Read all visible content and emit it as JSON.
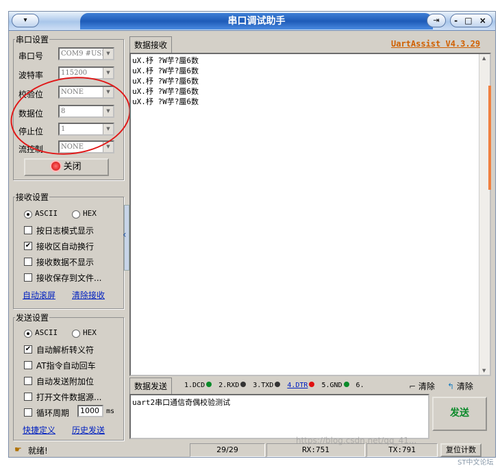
{
  "window": {
    "title": "串口调试助手",
    "version": "UartAssist V4.3.29",
    "controls": "- □ ×",
    "pin": "⇥"
  },
  "serial": {
    "legend": "串口设置",
    "port_label": "串口号",
    "port_value": "COM9 #USI",
    "baud_label": "波特率",
    "baud_value": "115200",
    "parity_label": "校验位",
    "parity_value": "NONE",
    "databits_label": "数据位",
    "databits_value": "8",
    "stopbits_label": "停止位",
    "stopbits_value": "1",
    "flow_label": "流控制",
    "flow_value": "NONE",
    "close_label": "关闭"
  },
  "recv": {
    "legend": "接收设置",
    "ascii": "ASCII",
    "hex": "HEX",
    "opt_log": "按日志模式显示",
    "opt_wrap": "接收区自动换行",
    "opt_hide": "接收数据不显示",
    "opt_save": "接收保存到文件...",
    "auto_scroll": "自动滚屏",
    "clear_recv": "清除接收"
  },
  "send": {
    "legend": "发送设置",
    "ascii": "ASCII",
    "hex": "HEX",
    "opt_escape": "自动解析转义符",
    "opt_at": "AT指令自动回车",
    "opt_append": "自动发送附加位",
    "opt_file": "打开文件数据源...",
    "opt_loop": "循环周期",
    "period": "1000",
    "unit": "ms",
    "shortcut": "快捷定义",
    "history": "历史发送"
  },
  "receive_area": {
    "tab": "数据接收",
    "lines": [
      "uX.杼  ?W芋?蜃6数",
      "uX.杼  ?W芋?蜃6数",
      "uX.杼  ?W芋?蜃6数",
      "uX.杼  ?W芋?蜃6数",
      "uX.杼  ?W芋?蜃6数"
    ]
  },
  "send_area": {
    "tab": "数据发送",
    "pins": [
      {
        "label": "1.DCD",
        "color": "#0a8a2a"
      },
      {
        "label": "2.RXD",
        "color": "#333333"
      },
      {
        "label": "3.TXD",
        "color": "#333333"
      },
      {
        "label": "4.DTR",
        "color": "#e01010"
      },
      {
        "label": "5.GND",
        "color": "#0a8a2a"
      },
      {
        "label": "6.",
        "color": "#333333"
      }
    ],
    "clear1": "清除",
    "clear2": "清除",
    "text": "uart2串口通信奇偶校验测试",
    "send_button": "发送"
  },
  "status": {
    "ready": "就绪!",
    "count": "29/29",
    "rx": "RX:751",
    "tx": "TX:791",
    "reset": "复位计数"
  },
  "watermark": "https://blog.csdn.net/qq_41...",
  "watermark2": "ST中文论坛"
}
